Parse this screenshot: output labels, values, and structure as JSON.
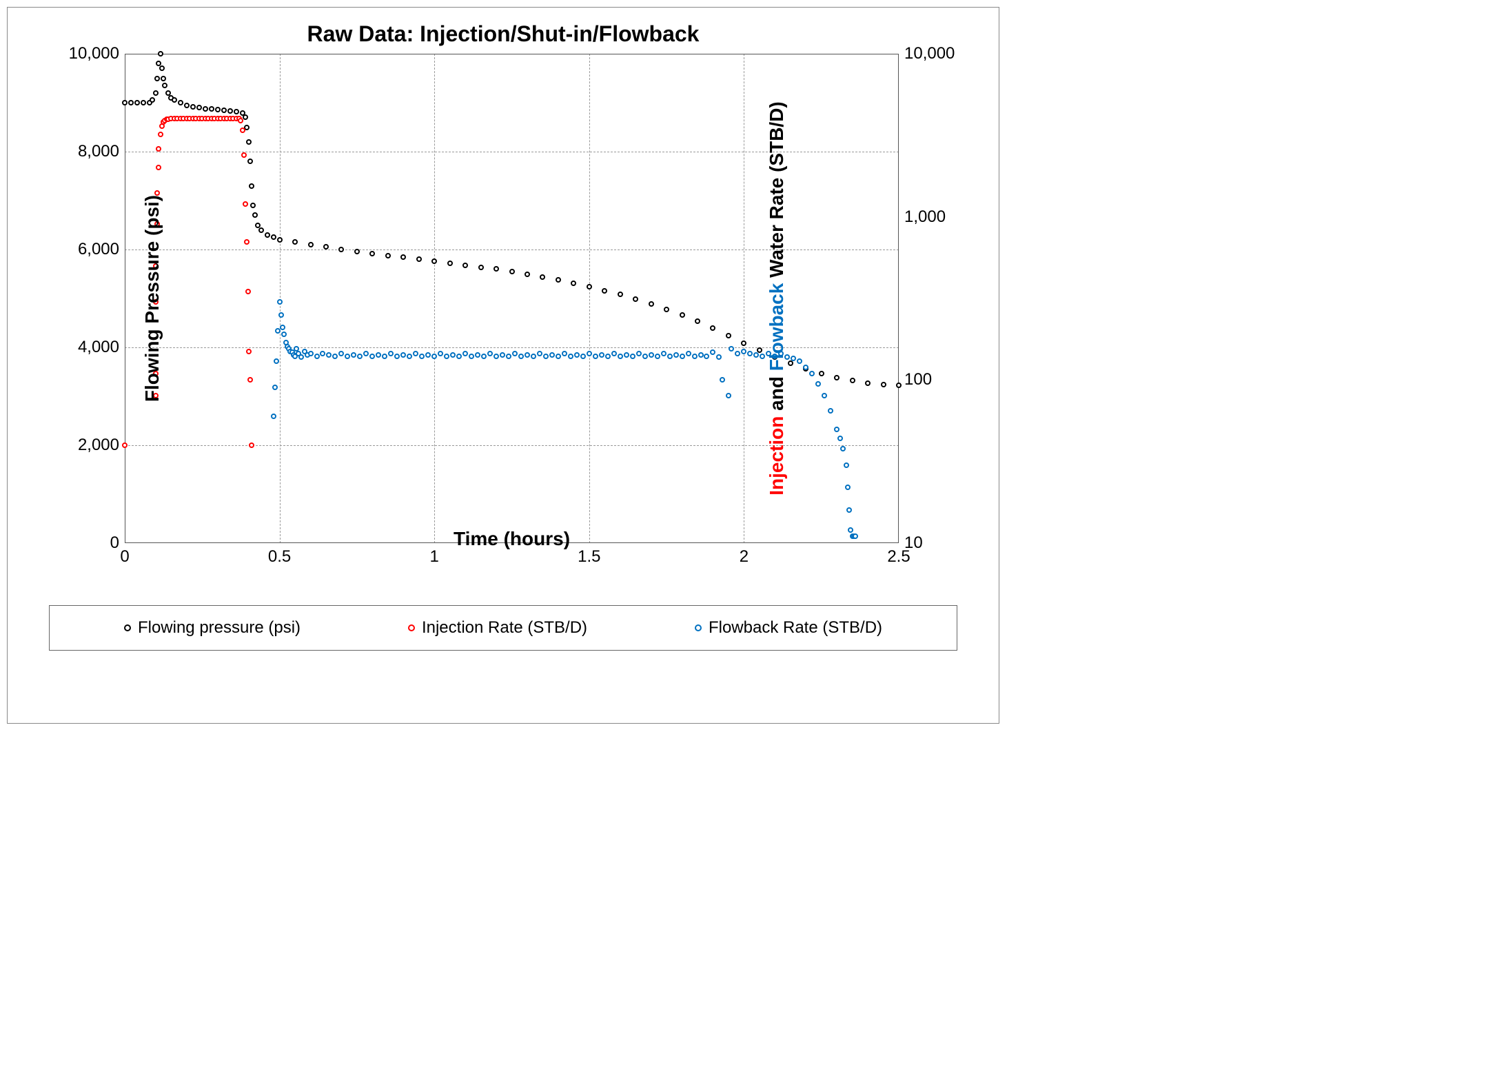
{
  "chart_data": {
    "type": "scatter",
    "title": "Raw Data: Injection/Shut-in/Flowback",
    "xlabel": "Time (hours)",
    "ylabel_left": "Flowing Pressure (psi)",
    "ylabel_right_parts": {
      "injection": "Injection",
      "and": " and ",
      "flowback": "Flowback",
      "rest": " Water Rate (STB/D)"
    },
    "x_ticks": [
      0,
      0.5,
      1,
      1.5,
      2,
      2.5
    ],
    "y_left_ticks": [
      0,
      2000,
      4000,
      6000,
      8000,
      10000
    ],
    "y_left_tick_labels": [
      "0",
      "2,000",
      "4,000",
      "6,000",
      "8,000",
      "10,000"
    ],
    "y_right_ticks": [
      10,
      100,
      1000,
      10000
    ],
    "y_right_tick_labels": [
      "10",
      "100",
      "1,000",
      "10,000"
    ],
    "xlim": [
      0,
      2.5
    ],
    "ylim_left": [
      0,
      10000
    ],
    "ylim_right": [
      10,
      10000
    ],
    "y_right_scale": "log",
    "legend": [
      {
        "label": "Flowing pressure (psi)",
        "color": "#000000"
      },
      {
        "label": "Injection Rate (STB/D)",
        "color": "#ff0000"
      },
      {
        "label": "Flowback Rate (STB/D)",
        "color": "#0070c0"
      }
    ],
    "series": [
      {
        "name": "Flowing pressure (psi)",
        "axis": "left",
        "color": "#000000",
        "points": [
          [
            0.0,
            9000
          ],
          [
            0.02,
            9000
          ],
          [
            0.04,
            9000
          ],
          [
            0.06,
            9000
          ],
          [
            0.08,
            9000
          ],
          [
            0.09,
            9050
          ],
          [
            0.1,
            9200
          ],
          [
            0.105,
            9500
          ],
          [
            0.11,
            9800
          ],
          [
            0.115,
            10000
          ],
          [
            0.12,
            9700
          ],
          [
            0.125,
            9500
          ],
          [
            0.13,
            9350
          ],
          [
            0.14,
            9200
          ],
          [
            0.15,
            9100
          ],
          [
            0.16,
            9050
          ],
          [
            0.18,
            9000
          ],
          [
            0.2,
            8950
          ],
          [
            0.22,
            8920
          ],
          [
            0.24,
            8900
          ],
          [
            0.26,
            8880
          ],
          [
            0.28,
            8870
          ],
          [
            0.3,
            8860
          ],
          [
            0.32,
            8850
          ],
          [
            0.34,
            8830
          ],
          [
            0.36,
            8810
          ],
          [
            0.38,
            8790
          ],
          [
            0.39,
            8700
          ],
          [
            0.395,
            8500
          ],
          [
            0.4,
            8200
          ],
          [
            0.405,
            7800
          ],
          [
            0.41,
            7300
          ],
          [
            0.415,
            6900
          ],
          [
            0.42,
            6700
          ],
          [
            0.43,
            6500
          ],
          [
            0.44,
            6400
          ],
          [
            0.46,
            6300
          ],
          [
            0.48,
            6250
          ],
          [
            0.5,
            6200
          ],
          [
            0.55,
            6150
          ],
          [
            0.6,
            6100
          ],
          [
            0.65,
            6050
          ],
          [
            0.7,
            6000
          ],
          [
            0.75,
            5960
          ],
          [
            0.8,
            5920
          ],
          [
            0.85,
            5880
          ],
          [
            0.9,
            5840
          ],
          [
            0.95,
            5800
          ],
          [
            1.0,
            5760
          ],
          [
            1.05,
            5720
          ],
          [
            1.1,
            5680
          ],
          [
            1.15,
            5640
          ],
          [
            1.2,
            5600
          ],
          [
            1.25,
            5550
          ],
          [
            1.3,
            5500
          ],
          [
            1.35,
            5440
          ],
          [
            1.4,
            5380
          ],
          [
            1.45,
            5310
          ],
          [
            1.5,
            5240
          ],
          [
            1.55,
            5160
          ],
          [
            1.6,
            5080
          ],
          [
            1.65,
            4990
          ],
          [
            1.7,
            4890
          ],
          [
            1.75,
            4780
          ],
          [
            1.8,
            4660
          ],
          [
            1.85,
            4530
          ],
          [
            1.9,
            4390
          ],
          [
            1.95,
            4240
          ],
          [
            2.0,
            4090
          ],
          [
            2.05,
            3940
          ],
          [
            2.1,
            3800
          ],
          [
            2.15,
            3680
          ],
          [
            2.2,
            3560
          ],
          [
            2.25,
            3460
          ],
          [
            2.3,
            3380
          ],
          [
            2.35,
            3320
          ],
          [
            2.4,
            3270
          ],
          [
            2.45,
            3240
          ],
          [
            2.5,
            3220
          ]
        ]
      },
      {
        "name": "Injection Rate (STB/D)",
        "axis": "right",
        "color": "#ff0000",
        "points": [
          [
            0.0,
            40
          ],
          [
            0.1,
            80
          ],
          [
            0.1,
            110
          ],
          [
            0.1,
            300
          ],
          [
            0.1,
            500
          ],
          [
            0.105,
            900
          ],
          [
            0.105,
            1400
          ],
          [
            0.11,
            2000
          ],
          [
            0.11,
            2600
          ],
          [
            0.115,
            3200
          ],
          [
            0.12,
            3600
          ],
          [
            0.125,
            3800
          ],
          [
            0.13,
            3900
          ],
          [
            0.135,
            3950
          ],
          [
            0.14,
            3980
          ],
          [
            0.15,
            4000
          ],
          [
            0.16,
            4000
          ],
          [
            0.17,
            4000
          ],
          [
            0.18,
            4000
          ],
          [
            0.19,
            4000
          ],
          [
            0.2,
            4000
          ],
          [
            0.21,
            4000
          ],
          [
            0.22,
            4000
          ],
          [
            0.23,
            4000
          ],
          [
            0.24,
            4000
          ],
          [
            0.25,
            4000
          ],
          [
            0.26,
            4000
          ],
          [
            0.27,
            4000
          ],
          [
            0.28,
            4000
          ],
          [
            0.29,
            4000
          ],
          [
            0.3,
            4000
          ],
          [
            0.31,
            4000
          ],
          [
            0.32,
            4000
          ],
          [
            0.33,
            4000
          ],
          [
            0.34,
            4000
          ],
          [
            0.35,
            4000
          ],
          [
            0.36,
            4000
          ],
          [
            0.37,
            4000
          ],
          [
            0.375,
            3900
          ],
          [
            0.38,
            3400
          ],
          [
            0.385,
            2400
          ],
          [
            0.39,
            1200
          ],
          [
            0.395,
            700
          ],
          [
            0.398,
            350
          ],
          [
            0.4,
            150
          ],
          [
            0.405,
            100
          ],
          [
            0.41,
            40
          ]
        ]
      },
      {
        "name": "Flowback Rate (STB/D)",
        "axis": "right",
        "color": "#0070c0",
        "points": [
          [
            0.48,
            60
          ],
          [
            0.485,
            90
          ],
          [
            0.49,
            130
          ],
          [
            0.495,
            200
          ],
          [
            0.5,
            300
          ],
          [
            0.505,
            250
          ],
          [
            0.51,
            210
          ],
          [
            0.515,
            190
          ],
          [
            0.52,
            170
          ],
          [
            0.525,
            160
          ],
          [
            0.53,
            155
          ],
          [
            0.535,
            150
          ],
          [
            0.54,
            148
          ],
          [
            0.545,
            142
          ],
          [
            0.55,
            140
          ],
          [
            0.555,
            155
          ],
          [
            0.56,
            145
          ],
          [
            0.57,
            138
          ],
          [
            0.58,
            150
          ],
          [
            0.59,
            142
          ],
          [
            0.6,
            145
          ],
          [
            0.62,
            140
          ],
          [
            0.64,
            145
          ],
          [
            0.66,
            142
          ],
          [
            0.68,
            140
          ],
          [
            0.7,
            145
          ],
          [
            0.72,
            140
          ],
          [
            0.74,
            142
          ],
          [
            0.76,
            140
          ],
          [
            0.78,
            145
          ],
          [
            0.8,
            140
          ],
          [
            0.82,
            142
          ],
          [
            0.84,
            140
          ],
          [
            0.86,
            145
          ],
          [
            0.88,
            140
          ],
          [
            0.9,
            142
          ],
          [
            0.92,
            140
          ],
          [
            0.94,
            145
          ],
          [
            0.96,
            140
          ],
          [
            0.98,
            142
          ],
          [
            1.0,
            140
          ],
          [
            1.02,
            145
          ],
          [
            1.04,
            140
          ],
          [
            1.06,
            142
          ],
          [
            1.08,
            140
          ],
          [
            1.1,
            145
          ],
          [
            1.12,
            140
          ],
          [
            1.14,
            142
          ],
          [
            1.16,
            140
          ],
          [
            1.18,
            145
          ],
          [
            1.2,
            140
          ],
          [
            1.22,
            142
          ],
          [
            1.24,
            140
          ],
          [
            1.26,
            145
          ],
          [
            1.28,
            140
          ],
          [
            1.3,
            142
          ],
          [
            1.32,
            140
          ],
          [
            1.34,
            145
          ],
          [
            1.36,
            140
          ],
          [
            1.38,
            142
          ],
          [
            1.4,
            140
          ],
          [
            1.42,
            145
          ],
          [
            1.44,
            140
          ],
          [
            1.46,
            142
          ],
          [
            1.48,
            140
          ],
          [
            1.5,
            145
          ],
          [
            1.52,
            140
          ],
          [
            1.54,
            142
          ],
          [
            1.56,
            140
          ],
          [
            1.58,
            145
          ],
          [
            1.6,
            140
          ],
          [
            1.62,
            142
          ],
          [
            1.64,
            140
          ],
          [
            1.66,
            145
          ],
          [
            1.68,
            140
          ],
          [
            1.7,
            142
          ],
          [
            1.72,
            140
          ],
          [
            1.74,
            145
          ],
          [
            1.76,
            140
          ],
          [
            1.78,
            142
          ],
          [
            1.8,
            140
          ],
          [
            1.82,
            145
          ],
          [
            1.84,
            140
          ],
          [
            1.86,
            142
          ],
          [
            1.88,
            140
          ],
          [
            1.9,
            148
          ],
          [
            1.92,
            138
          ],
          [
            1.93,
            100
          ],
          [
            1.95,
            80
          ],
          [
            1.96,
            155
          ],
          [
            1.98,
            145
          ],
          [
            2.0,
            150
          ],
          [
            2.02,
            145
          ],
          [
            2.04,
            142
          ],
          [
            2.06,
            140
          ],
          [
            2.08,
            145
          ],
          [
            2.1,
            140
          ],
          [
            2.12,
            145
          ],
          [
            2.14,
            138
          ],
          [
            2.16,
            135
          ],
          [
            2.18,
            130
          ],
          [
            2.2,
            120
          ],
          [
            2.22,
            110
          ],
          [
            2.24,
            95
          ],
          [
            2.26,
            80
          ],
          [
            2.28,
            65
          ],
          [
            2.3,
            50
          ],
          [
            2.31,
            44
          ],
          [
            2.32,
            38
          ],
          [
            2.33,
            30
          ],
          [
            2.335,
            22
          ],
          [
            2.34,
            16
          ],
          [
            2.345,
            12
          ],
          [
            2.35,
            11
          ],
          [
            2.355,
            11
          ],
          [
            2.36,
            11
          ]
        ]
      }
    ]
  }
}
